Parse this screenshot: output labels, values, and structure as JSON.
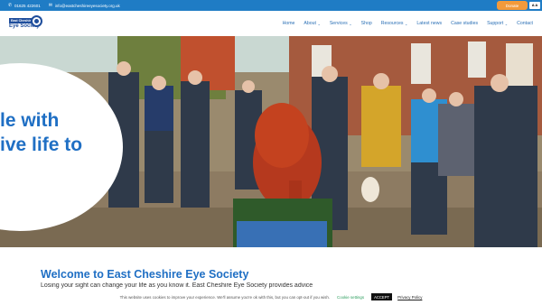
{
  "topbar": {
    "phone": "01625 422601",
    "email": "info@eastcheshireeyesociety.org.uk",
    "donate_label": "Donate",
    "a11y_label": "A A"
  },
  "logo": {
    "line1": "East Cheshire",
    "line2": "Eye Society"
  },
  "nav": {
    "items": [
      {
        "label": "Home"
      },
      {
        "label": "About",
        "dropdown": true
      },
      {
        "label": "Services",
        "dropdown": true
      },
      {
        "label": "Shop"
      },
      {
        "label": "Resources",
        "dropdown": true
      },
      {
        "label": "Latest news"
      },
      {
        "label": "Case studies"
      },
      {
        "label": "Support",
        "dropdown": true
      },
      {
        "label": "Contact"
      }
    ]
  },
  "hero": {
    "line1": "le with",
    "line2": "ive life to"
  },
  "main": {
    "welcome_title": "Welcome to East Cheshire Eye Society",
    "intro_text": "Losing your sight can change your life as you know it. East Cheshire Eye Society provides advice"
  },
  "cookie": {
    "text": "This website uses cookies to improve your experience. We'll assume you're ok with this, but you can opt-out if you wish.",
    "settings_label": "Cookie settings",
    "accept_label": "ACCEPT",
    "privacy_label": "Privacy Policy"
  },
  "colors": {
    "topbar": "#1f7cc5",
    "donate": "#f29a3b",
    "accent": "#1f6fc4"
  }
}
